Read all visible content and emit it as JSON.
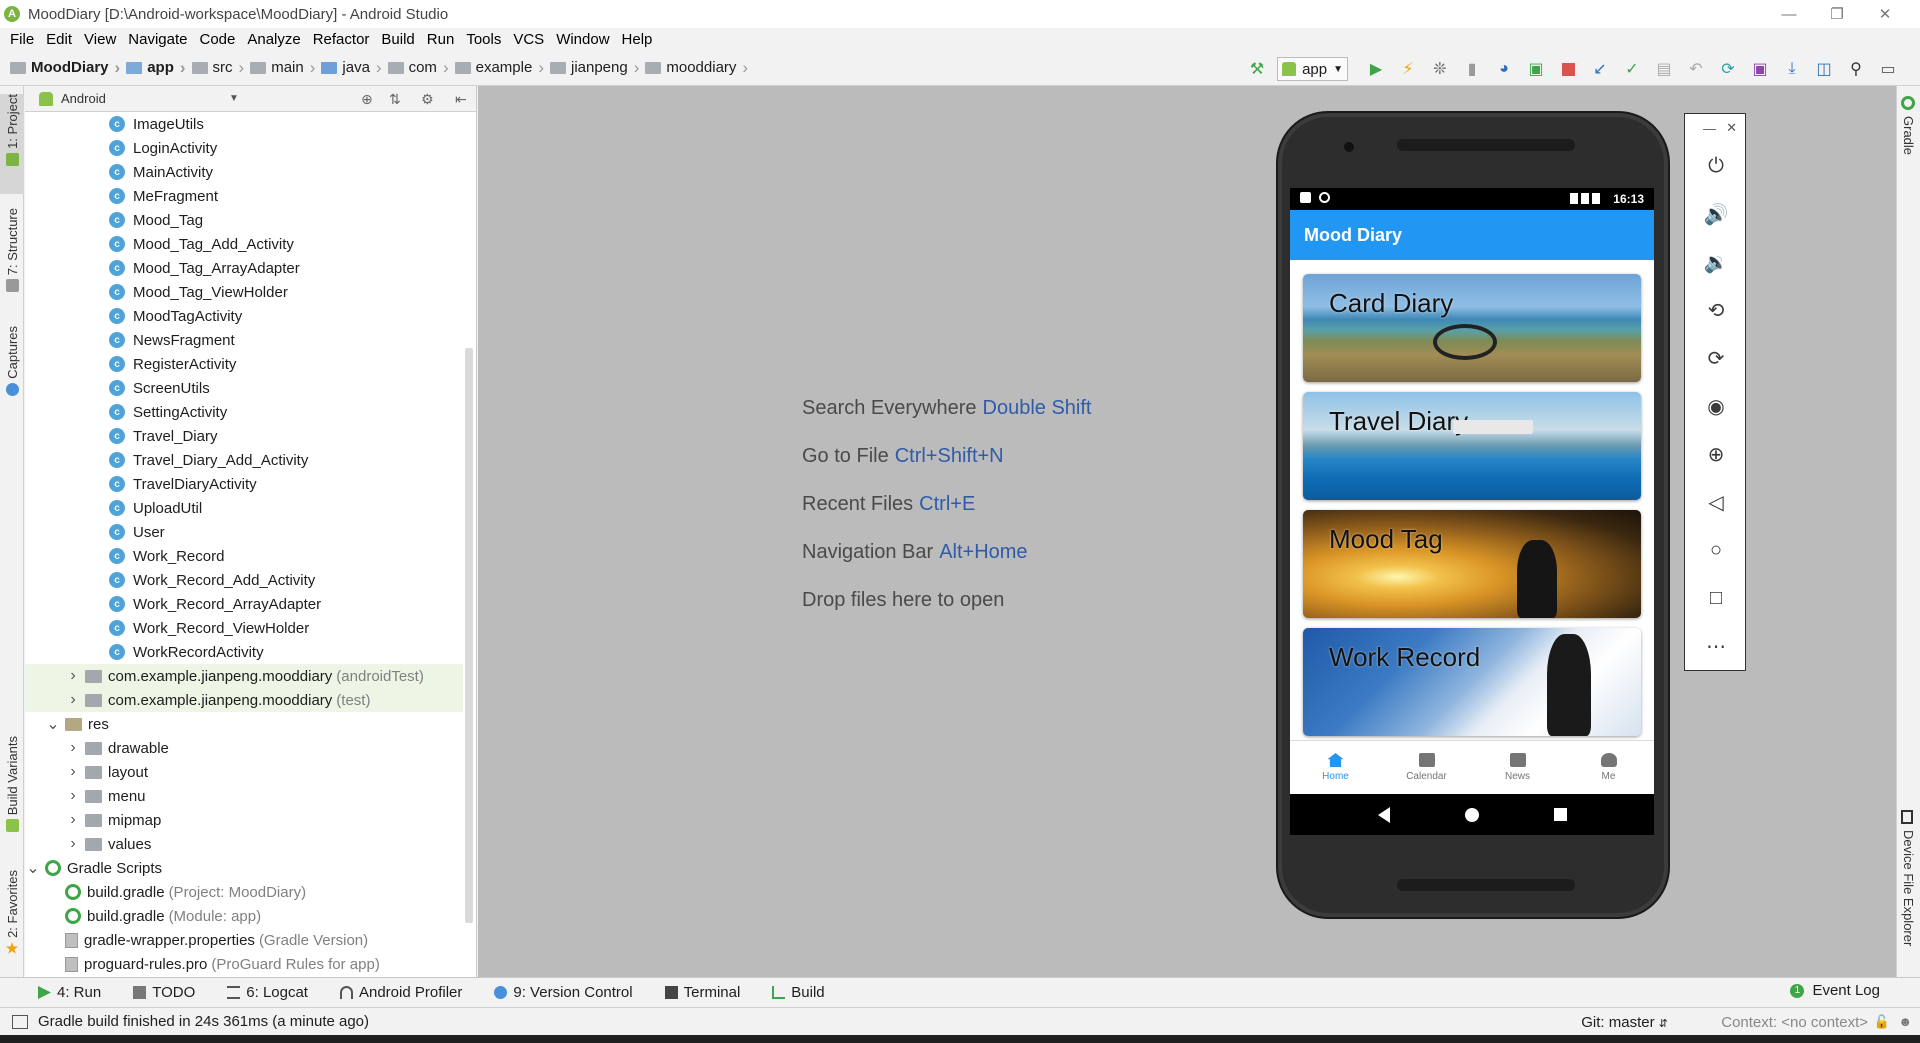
{
  "window": {
    "title": "MoodDiary [D:\\Android-workspace\\MoodDiary] - Android Studio"
  },
  "menu": [
    "File",
    "Edit",
    "View",
    "Navigate",
    "Code",
    "Analyze",
    "Refactor",
    "Build",
    "Run",
    "Tools",
    "VCS",
    "Window",
    "Help"
  ],
  "breadcrumb": [
    "MoodDiary",
    "app",
    "src",
    "main",
    "java",
    "com",
    "example",
    "jianpeng",
    "mooddiary"
  ],
  "run_config": "app",
  "left_tabs": [
    "1: Project",
    "7: Structure",
    "Captures",
    "Build Variants",
    "2: Favorites"
  ],
  "right_tabs": [
    "Gradle",
    "Device File Explorer"
  ],
  "project_view": {
    "mode": "Android",
    "classes": [
      "ImageUtils",
      "LoginActivity",
      "MainActivity",
      "MeFragment",
      "Mood_Tag",
      "Mood_Tag_Add_Activity",
      "Mood_Tag_ArrayAdapter",
      "Mood_Tag_ViewHolder",
      "MoodTagActivity",
      "NewsFragment",
      "RegisterActivity",
      "ScreenUtils",
      "SettingActivity",
      "Travel_Diary",
      "Travel_Diary_Add_Activity",
      "TravelDiaryActivity",
      "UploadUtil",
      "User",
      "Work_Record",
      "Work_Record_Add_Activity",
      "Work_Record_ArrayAdapter",
      "Work_Record_ViewHolder",
      "WorkRecordActivity"
    ],
    "packages": [
      {
        "name": "com.example.jianpeng.mooddiary",
        "suffix": "(androidTest)"
      },
      {
        "name": "com.example.jianpeng.mooddiary",
        "suffix": "(test)"
      }
    ],
    "res_label": "res",
    "res_folders": [
      "drawable",
      "layout",
      "menu",
      "mipmap",
      "values"
    ],
    "gradle_label": "Gradle Scripts",
    "gradle_files": [
      {
        "name": "build.gradle",
        "suffix": "(Project: MoodDiary)"
      },
      {
        "name": "build.gradle",
        "suffix": "(Module: app)"
      },
      {
        "name": "gradle-wrapper.properties",
        "suffix": "(Gradle Version)"
      },
      {
        "name": "proguard-rules.pro",
        "suffix": "(ProGuard Rules for app)"
      }
    ]
  },
  "editor_hints": [
    {
      "text": "Search Everywhere",
      "key": "Double Shift"
    },
    {
      "text": "Go to File",
      "key": "Ctrl+Shift+N"
    },
    {
      "text": "Recent Files",
      "key": "Ctrl+E"
    },
    {
      "text": "Navigation Bar",
      "key": "Alt+Home"
    },
    {
      "text": "Drop files here to open",
      "key": ""
    }
  ],
  "emulator": {
    "time": "16:13",
    "app_title": "Mood Diary",
    "cards": [
      "Card Diary",
      "Travel Diary",
      "Mood Tag",
      "Work Record"
    ],
    "bottom_nav": [
      "Home",
      "Calendar",
      "News",
      "Me"
    ],
    "active_tab": "Home"
  },
  "bottom_tools": [
    {
      "label": "4: Run",
      "icon": "run-icon"
    },
    {
      "label": "TODO",
      "icon": "todo-icon"
    },
    {
      "label": "6: Logcat",
      "icon": "logcat-icon"
    },
    {
      "label": "Android Profiler",
      "icon": "profiler-icon"
    },
    {
      "label": "9: Version Control",
      "icon": "vcs-icon"
    },
    {
      "label": "Terminal",
      "icon": "terminal-icon"
    },
    {
      "label": "Build",
      "icon": "build-icon"
    }
  ],
  "event_log": {
    "count": "1",
    "label": "Event Log"
  },
  "status": {
    "message": "Gradle build finished in 24s 361ms (a minute ago)",
    "git": "Git: master",
    "context": "Context: <no context>"
  },
  "colors": {
    "accent": "#2196f3",
    "hint_key": "#2f5ba8",
    "editor_bg": "#bbbbbb"
  }
}
